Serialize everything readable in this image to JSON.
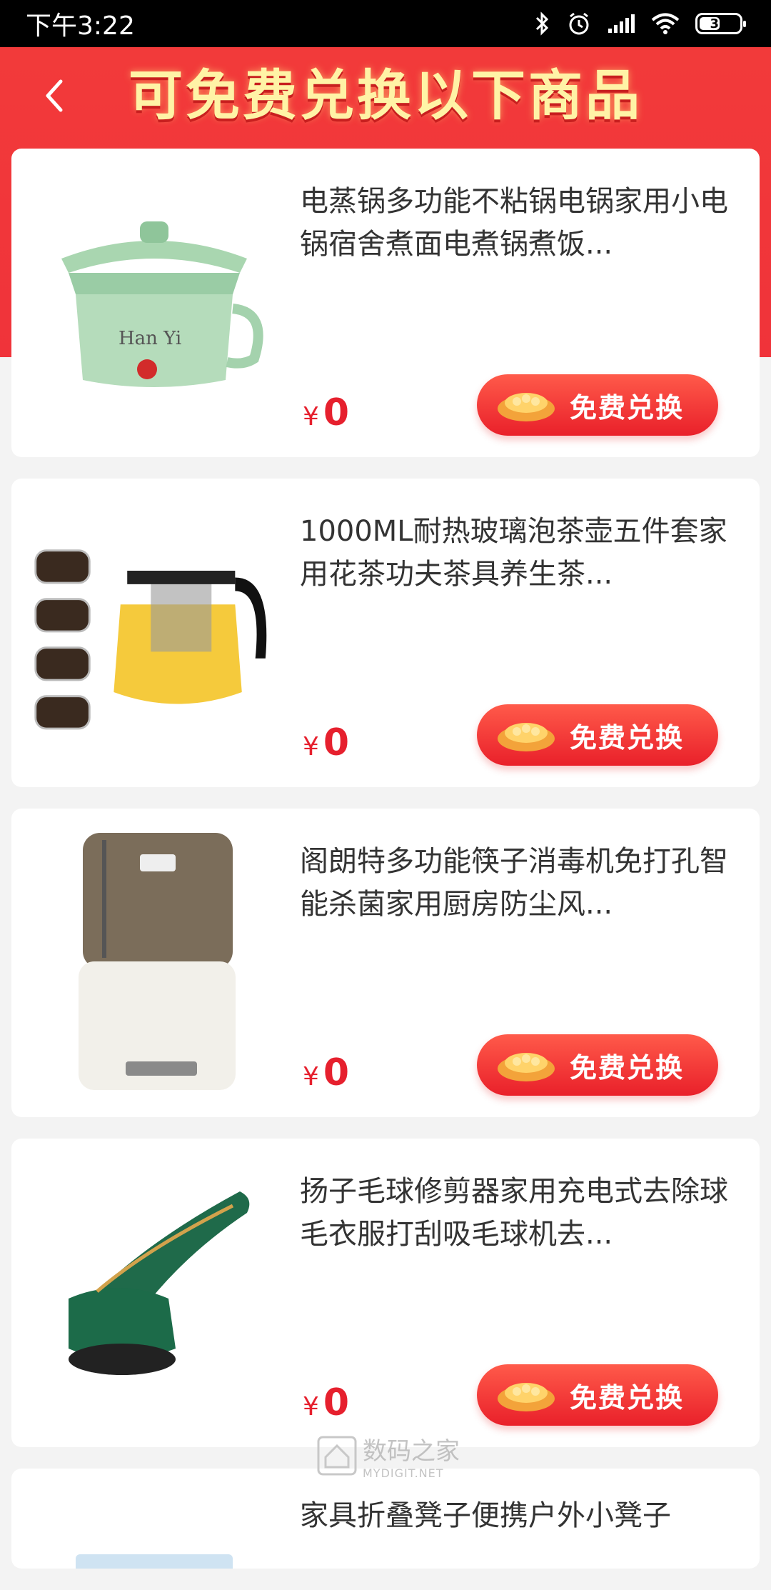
{
  "status_bar": {
    "time": "下午3:22",
    "battery": "32"
  },
  "header": {
    "title": "可免费兑换以下商品"
  },
  "products": [
    {
      "name": "电蒸锅多功能不粘锅电锅家用小电锅宿舍煮面电煮锅煮饭...",
      "currency": "¥",
      "price": "0",
      "button": "免费兑换"
    },
    {
      "name": "1000ML耐热玻璃泡茶壶五件套家用花茶功夫茶具养生茶...",
      "currency": "¥",
      "price": "0",
      "button": "免费兑换"
    },
    {
      "name": "阁朗特多功能筷子消毒机免打孔智能杀菌家用厨房防尘风...",
      "currency": "¥",
      "price": "0",
      "button": "免费兑换"
    },
    {
      "name": "扬子毛球修剪器家用充电式去除球毛衣服打刮吸毛球机去...",
      "currency": "¥",
      "price": "0",
      "button": "免费兑换"
    },
    {
      "name": "家具折叠凳子便携户外小凳子"
    }
  ],
  "watermark": {
    "text": "数码之家",
    "sub": "MYDIGIT.NET"
  },
  "colors": {
    "accent": "#f23a3a",
    "price": "#e6202e",
    "title": "#fff3a6"
  }
}
